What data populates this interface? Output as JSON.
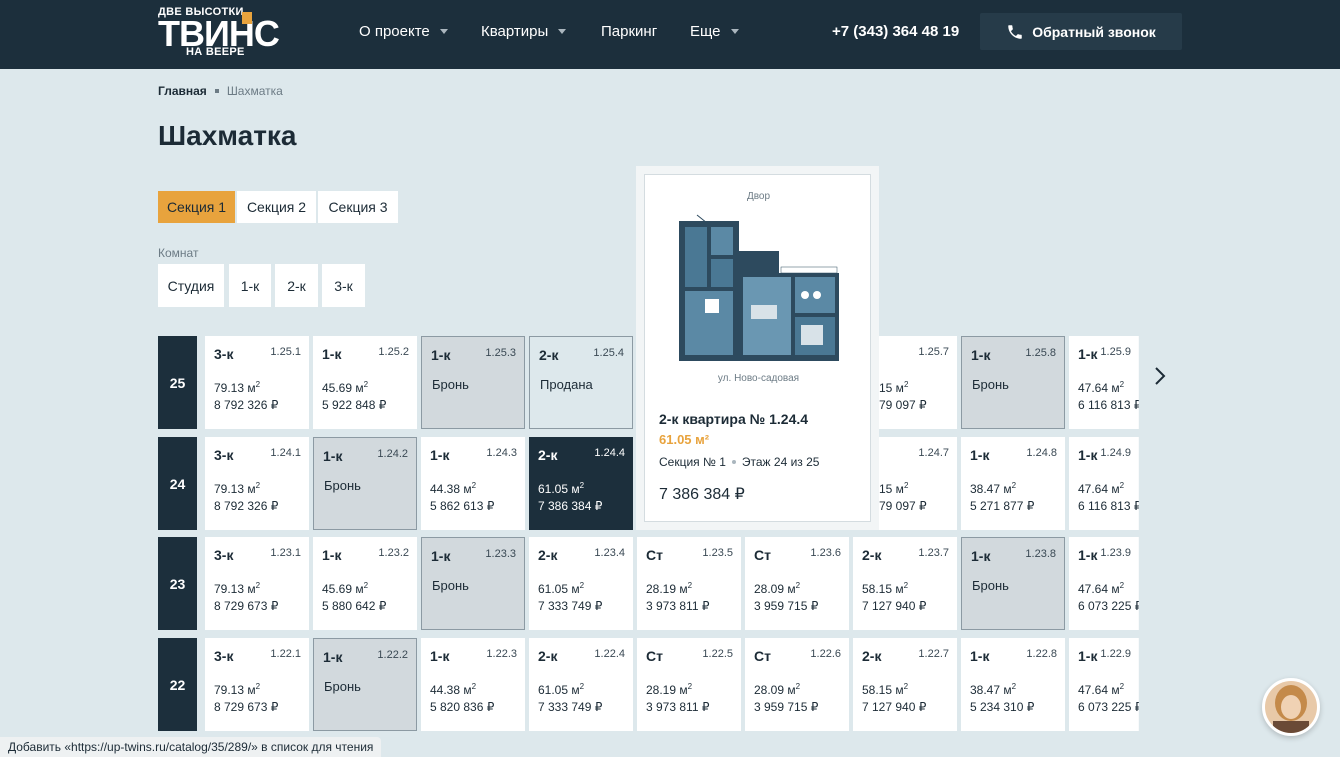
{
  "header": {
    "logo_top": "ДВЕ ВЫСОТКИ",
    "logo_main": "ТВИНС",
    "logo_bottom": "НА ВЕЕРЕ",
    "nav": [
      {
        "label": "О проекте",
        "dropdown": true
      },
      {
        "label": "Квартиры",
        "dropdown": true
      },
      {
        "label": "Паркинг",
        "dropdown": false
      },
      {
        "label": "Еще",
        "dropdown": true
      }
    ],
    "phone": "+7 (343) 364 48 19",
    "callback_label": "Обратный звонок",
    "colors": {
      "bg": "#1c2f3c",
      "accent": "#e8a33d"
    }
  },
  "breadcrumbs": {
    "home": "Главная",
    "current": "Шахматка"
  },
  "page_title": "Шахматка",
  "sections": [
    {
      "label": "Секция 1",
      "active": true
    },
    {
      "label": "Секция 2",
      "active": false
    },
    {
      "label": "Секция 3",
      "active": false
    }
  ],
  "rooms_label": "Комнат",
  "room_filters": [
    "Студия",
    "1-к",
    "2-к",
    "3-к"
  ],
  "floors": [
    {
      "floor": "25",
      "cells": [
        {
          "type": "3-к",
          "num": "1.25.1",
          "area": "79.13 м",
          "price": "8 792 326 ₽"
        },
        {
          "type": "1-к",
          "num": "1.25.2",
          "area": "45.69 м",
          "price": "5 922 848 ₽"
        },
        {
          "type": "1-к",
          "num": "1.25.3",
          "status": "Бронь",
          "state": "booked"
        },
        {
          "type": "2-к",
          "num": "1.25.4",
          "status": "Продана",
          "state": "sold"
        },
        {
          "type": "",
          "num": "",
          "area": "",
          "price": "",
          "state": "hidden"
        },
        {
          "type": "",
          "num": "",
          "area": "",
          "price": "",
          "state": "hidden"
        },
        {
          "type": "",
          "num": "1.25.7",
          "area": "15 м",
          "price": "79 097 ₽",
          "partial": true
        },
        {
          "type": "1-к",
          "num": "1.25.8",
          "status": "Бронь",
          "state": "booked"
        },
        {
          "type": "1-к",
          "num": "1.25.9",
          "area": "47.64 м",
          "price": "6 116 813 ₽"
        }
      ]
    },
    {
      "floor": "24",
      "cells": [
        {
          "type": "3-к",
          "num": "1.24.1",
          "area": "79.13 м",
          "price": "8 792 326 ₽"
        },
        {
          "type": "1-к",
          "num": "1.24.2",
          "status": "Бронь",
          "state": "booked"
        },
        {
          "type": "1-к",
          "num": "1.24.3",
          "area": "44.38 м",
          "price": "5 862 613 ₽"
        },
        {
          "type": "2-к",
          "num": "1.24.4",
          "area": "61.05 м",
          "price": "7 386 384 ₽",
          "state": "dark"
        },
        {
          "type": "",
          "num": "",
          "area": "",
          "price": "",
          "state": "hidden"
        },
        {
          "type": "",
          "num": "",
          "area": "",
          "price": "",
          "state": "hidden"
        },
        {
          "type": "",
          "num": "1.24.7",
          "area": "15 м",
          "price": "79 097 ₽",
          "partial": true
        },
        {
          "type": "1-к",
          "num": "1.24.8",
          "area": "38.47 м",
          "price": "5 271 877 ₽"
        },
        {
          "type": "1-к",
          "num": "1.24.9",
          "area": "47.64 м",
          "price": "6 116 813 ₽"
        }
      ]
    },
    {
      "floor": "23",
      "cells": [
        {
          "type": "3-к",
          "num": "1.23.1",
          "area": "79.13 м",
          "price": "8 729 673 ₽"
        },
        {
          "type": "1-к",
          "num": "1.23.2",
          "area": "45.69 м",
          "price": "5 880 642 ₽"
        },
        {
          "type": "1-к",
          "num": "1.23.3",
          "status": "Бронь",
          "state": "booked"
        },
        {
          "type": "2-к",
          "num": "1.23.4",
          "area": "61.05 м",
          "price": "7 333 749 ₽"
        },
        {
          "type": "Ст",
          "num": "1.23.5",
          "area": "28.19 м",
          "price": "3 973 811 ₽"
        },
        {
          "type": "Ст",
          "num": "1.23.6",
          "area": "28.09 м",
          "price": "3 959 715 ₽"
        },
        {
          "type": "2-к",
          "num": "1.23.7",
          "area": "58.15 м",
          "price": "7 127 940 ₽"
        },
        {
          "type": "1-к",
          "num": "1.23.8",
          "status": "Бронь",
          "state": "booked"
        },
        {
          "type": "1-к",
          "num": "1.23.9",
          "area": "47.64 м",
          "price": "6 073 225 ₽"
        }
      ]
    },
    {
      "floor": "22",
      "cells": [
        {
          "type": "3-к",
          "num": "1.22.1",
          "area": "79.13 м",
          "price": "8 729 673 ₽"
        },
        {
          "type": "1-к",
          "num": "1.22.2",
          "status": "Бронь",
          "state": "booked"
        },
        {
          "type": "1-к",
          "num": "1.22.3",
          "area": "44.38 м",
          "price": "5 820 836 ₽"
        },
        {
          "type": "2-к",
          "num": "1.22.4",
          "area": "61.05 м",
          "price": "7 333 749 ₽"
        },
        {
          "type": "Ст",
          "num": "1.22.5",
          "area": "28.19 м",
          "price": "3 973 811 ₽"
        },
        {
          "type": "Ст",
          "num": "1.22.6",
          "area": "28.09 м",
          "price": "3 959 715 ₽"
        },
        {
          "type": "2-к",
          "num": "1.22.7",
          "area": "58.15 м",
          "price": "7 127 940 ₽"
        },
        {
          "type": "1-к",
          "num": "1.22.8",
          "area": "38.47 м",
          "price": "5 234 310 ₽"
        },
        {
          "type": "1-к",
          "num": "1.22.9",
          "area": "47.64 м",
          "price": "6 073 225 ₽"
        }
      ]
    }
  ],
  "popup": {
    "yard": "Двор",
    "street": "ул. Ново-садовая",
    "title": "2-к квартира № 1.24.4",
    "area": "61.05 м²",
    "section": "Секция № 1",
    "floor": "Этаж 24 из 25",
    "price": "7 386 384 ₽"
  },
  "browser_status": "Добавить «https://up-twins.ru/catalog/35/289/» в список для чтения"
}
